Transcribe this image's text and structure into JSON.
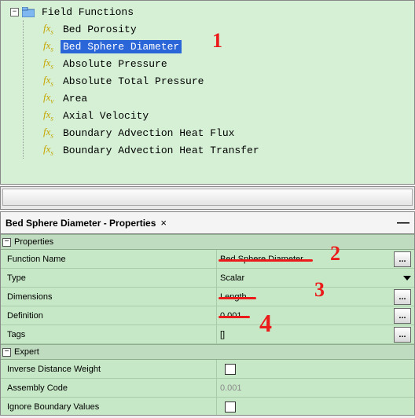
{
  "tree": {
    "root_label": "Field Functions",
    "items": [
      {
        "label": "Bed Porosity",
        "fx_sub": "s",
        "selected": false
      },
      {
        "label": "Bed Sphere Diameter",
        "fx_sub": "s",
        "selected": true
      },
      {
        "label": "Absolute Pressure",
        "fx_sub": "s",
        "selected": false
      },
      {
        "label": "Absolute Total Pressure",
        "fx_sub": "s",
        "selected": false
      },
      {
        "label": "Area",
        "fx_sub": "v",
        "selected": false
      },
      {
        "label": "Axial Velocity",
        "fx_sub": "s",
        "selected": false
      },
      {
        "label": "Boundary Advection Heat Flux",
        "fx_sub": "s",
        "selected": false
      },
      {
        "label": "Boundary Advection Heat Transfer",
        "fx_sub": "s",
        "selected": false
      }
    ]
  },
  "properties": {
    "title": "Bed Sphere Diameter - Properties",
    "group1": "Properties",
    "group2": "Expert",
    "rows": {
      "function_name": {
        "label": "Function Name",
        "value": "Bed Sphere Diameter"
      },
      "type": {
        "label": "Type",
        "value": "Scalar"
      },
      "dimensions": {
        "label": "Dimensions",
        "value": "Length"
      },
      "definition": {
        "label": "Definition",
        "value": "0.001"
      },
      "tags": {
        "label": "Tags",
        "value": "[]"
      },
      "idw": {
        "label": "Inverse Distance Weight",
        "value": ""
      },
      "assembly": {
        "label": "Assembly Code",
        "value": "0.001"
      },
      "ignore": {
        "label": "Ignore Boundary Values",
        "value": ""
      }
    }
  },
  "annotations": {
    "a1": "1",
    "a2": "2",
    "a3": "3",
    "a4": "4"
  }
}
